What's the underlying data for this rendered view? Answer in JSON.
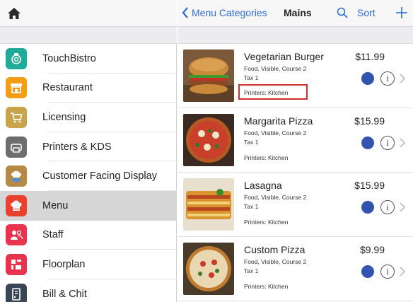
{
  "sidebar": {
    "home_icon": "home-icon",
    "items": [
      {
        "label": "TouchBistro",
        "icon": "touchbistro-icon",
        "color": "#1faa9a",
        "selected": false
      },
      {
        "label": "Restaurant",
        "icon": "storefront-icon",
        "color": "#f29d13",
        "selected": false
      },
      {
        "label": "Licensing",
        "icon": "cart-icon",
        "color": "#c9a44a",
        "selected": false
      },
      {
        "label": "Printers & KDS",
        "icon": "printer-icon",
        "color": "#6e6e6e",
        "selected": false
      },
      {
        "label": "Customer Facing Display",
        "icon": "cfd-chef-icon",
        "color": "#b58a44",
        "selected": false
      },
      {
        "label": "Menu",
        "icon": "chef-hat-icon",
        "color": "#e8422f",
        "selected": true
      },
      {
        "label": "Staff",
        "icon": "people-icon",
        "color": "#e8334f",
        "selected": false
      },
      {
        "label": "Floorplan",
        "icon": "floorplan-icon",
        "color": "#e8334f",
        "selected": false
      },
      {
        "label": "Bill & Chit",
        "icon": "receipt-icon",
        "color": "#3a4656",
        "selected": false
      }
    ]
  },
  "header": {
    "back_label": "Menu Categories",
    "title": "Mains",
    "sort_label": "Sort",
    "accent": "#2c6dd6"
  },
  "menu_items": [
    {
      "name": "Vegetarian Burger",
      "meta": "Food, Visible, Course 2",
      "tax": "Tax 1",
      "printers": "Printers: Kitchen",
      "price": "$11.99",
      "image": "burger",
      "color": "#3353b0",
      "highlighted": true
    },
    {
      "name": "Margarita Pizza",
      "meta": "Food, Visible, Course 2",
      "tax": "Tax 1",
      "printers": "Printers: Kitchen",
      "price": "$15.99",
      "image": "pizza",
      "color": "#3353b0",
      "highlighted": false
    },
    {
      "name": "Lasagna",
      "meta": "Food, Visible, Course 2",
      "tax": "Tax 1",
      "printers": "Printers: Kitchen",
      "price": "$15.99",
      "image": "lasagna",
      "color": "#3353b0",
      "highlighted": false
    },
    {
      "name": "Custom Pizza",
      "meta": "Food, Visible, Course 2",
      "tax": "Tax 1",
      "printers": "Printers: Kitchen",
      "price": "$9.99",
      "image": "custom-pizza",
      "color": "#3353b0",
      "highlighted": false
    }
  ],
  "info_glyph": "i"
}
